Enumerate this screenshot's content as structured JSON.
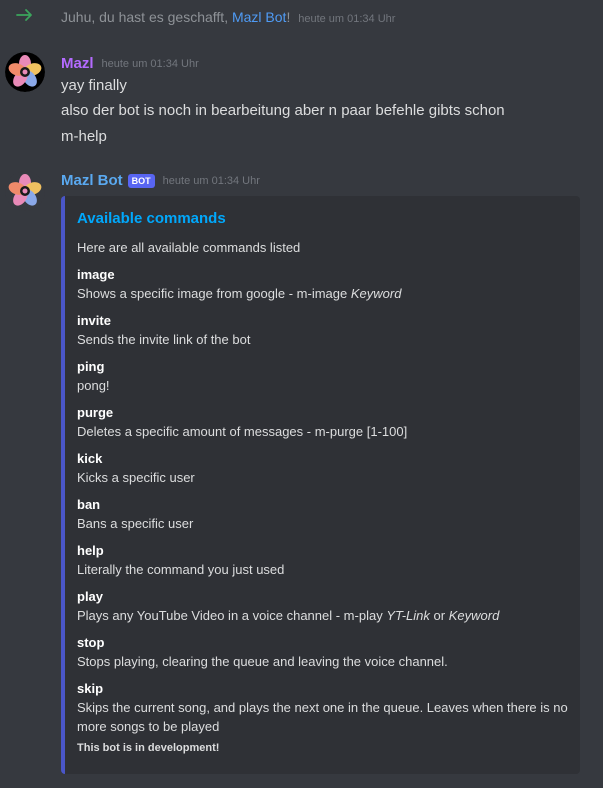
{
  "join": {
    "text": "Juhu, du hast es geschafft,",
    "bot_name": "Mazl Bot",
    "punct": "!",
    "timestamp": "heute um 01:34 Uhr"
  },
  "messages": [
    {
      "author": "Mazl",
      "timestamp": "heute um 01:34 Uhr",
      "lines": [
        "yay finally",
        "also der bot is noch in bearbeitung aber n paar befehle gibts schon",
        "m-help"
      ]
    },
    {
      "author": "Mazl Bot",
      "badge": "BOT",
      "timestamp": "heute um 01:34 Uhr"
    }
  ],
  "embed": {
    "title": "Available commands",
    "description": "Here are all available commands listed",
    "fields": [
      {
        "name": "image",
        "value": "Shows a specific image from google - m-image ",
        "value_em": "Keyword"
      },
      {
        "name": "invite",
        "value": "Sends the invite link of the bot"
      },
      {
        "name": "ping",
        "value": "pong!"
      },
      {
        "name": "purge",
        "value": "Deletes a specific amount of messages - m-purge [1-100]"
      },
      {
        "name": "kick",
        "value": "Kicks a specific user"
      },
      {
        "name": "ban",
        "value": "Bans a specific user"
      },
      {
        "name": "help",
        "value": "Literally the command you just used"
      },
      {
        "name": "play",
        "value": "Plays any YouTube Video in a voice channel - m-play ",
        "value_em": "YT-Link",
        "value_mid": " or ",
        "value_em2": "Keyword"
      },
      {
        "name": "stop",
        "value": "Stops playing, clearing the queue and leaving the voice channel."
      },
      {
        "name": "skip",
        "value": "Skips the current song, and plays the next one in the queue. Leaves when there is no more songs to be played"
      }
    ],
    "footer": "This bot is in development!"
  },
  "colors": {
    "background": "#36393f",
    "embed_bg": "#2f3136",
    "embed_border": "#4a56c8",
    "mazl_name": "#b46bff",
    "bot_name": "#5aa9f0",
    "embed_title": "#00a8fc",
    "join_arrow": "#3ba55c",
    "bot_badge": "#5865f2"
  },
  "icons": {
    "join": "arrow-right-icon",
    "avatar": "flower-avatar-icon"
  }
}
